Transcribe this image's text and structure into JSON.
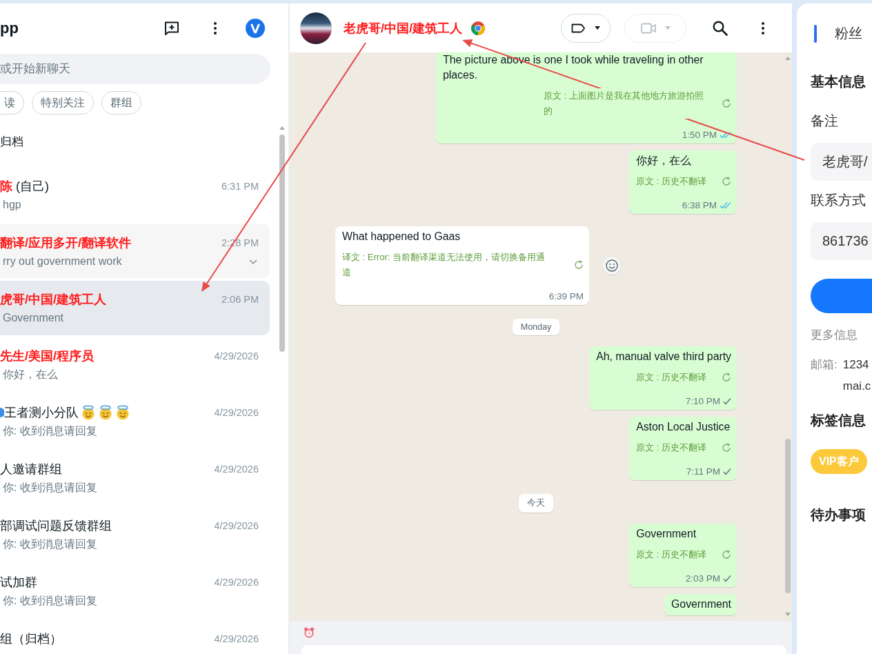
{
  "sidebar": {
    "title": "pp",
    "search": {
      "placeholder": "或开始新聊天"
    },
    "filters": [
      {
        "label": "读",
        "selected": false
      },
      {
        "label": "特别关注",
        "selected": false
      },
      {
        "label": "群组",
        "selected": false
      }
    ],
    "archived": {
      "label": "归档"
    },
    "chats": [
      {
        "name": "陈",
        "note": "(自己)",
        "highlighted": true,
        "time": "6:31 PM",
        "preview": "hgp",
        "selected": false,
        "hovered": false
      },
      {
        "name": "翻译/应用多开/翻译软件",
        "highlighted": true,
        "time": "2:28 PM",
        "preview": "rry out government work",
        "selected": false,
        "hovered": true
      },
      {
        "name": "虎哥/中国/建筑工人",
        "highlighted": true,
        "time": "2:06 PM",
        "preview": "Government",
        "selected": true,
        "hovered": false
      },
      {
        "name": "先生/美国/程序员",
        "highlighted": true,
        "time": "4/29/2026",
        "preview": "你好，在么",
        "selected": false,
        "hovered": false
      },
      {
        "name": "王者测小分队",
        "icons_before": [
          {
            "kind": "dot"
          }
        ],
        "icons_after": [
          {
            "kind": "halo-face"
          },
          {
            "kind": "halo-face"
          },
          {
            "kind": "halo-face"
          }
        ],
        "highlighted": false,
        "time": "4/29/2026",
        "preview": "你: 收到消息请回复",
        "selected": false,
        "hovered": false
      },
      {
        "name": "人邀请群组",
        "highlighted": false,
        "time": "4/29/2026",
        "preview": "你: 收到消息请回复",
        "selected": false,
        "hovered": false
      },
      {
        "name": "部调试问题反馈群组",
        "highlighted": false,
        "time": "4/29/2026",
        "preview": "你: 收到消息请回复",
        "selected": false,
        "hovered": false
      },
      {
        "name": "试加群",
        "highlighted": false,
        "time": "4/29/2026",
        "preview": "你: 收到消息请回复",
        "selected": false,
        "hovered": false
      },
      {
        "name": "组（归档）",
        "highlighted": false,
        "time": "4/29/2026",
        "selected": false,
        "hovered": false
      }
    ]
  },
  "chat": {
    "contact": {
      "name": "老虎哥/中国/建筑工人",
      "highlighted": true
    },
    "header_buttons": [
      {
        "kind": "label",
        "disabled": false
      },
      {
        "kind": "video",
        "disabled": true
      }
    ],
    "messages": [
      {
        "kind": "message",
        "outgoing": true,
        "text": "The picture above is one I took while traveling in other places.",
        "translation": "原文 : 上面图片是我在其他地方旅游拍照的",
        "time": "1:50 PM",
        "read": true
      },
      {
        "kind": "message",
        "outgoing": true,
        "text": "你好，在么",
        "translation": "原文 : 历史不翻译",
        "time": "6:38 PM",
        "read": true
      },
      {
        "kind": "message",
        "outgoing": false,
        "text": "What happened to Gaas",
        "translation": "译文 : Error: 当前翻译渠道无法使用，请切换备用通道",
        "time": "6:39 PM",
        "react_button": true
      },
      {
        "kind": "date",
        "label": "Monday"
      },
      {
        "kind": "message",
        "outgoing": true,
        "text": "Ah, manual valve third party",
        "translation": "原文 : 历史不翻译",
        "time": "7:10 PM",
        "read": false
      },
      {
        "kind": "message",
        "outgoing": true,
        "text": "Aston Local Justice",
        "translation": "原文 : 历史不翻译",
        "time": "7:11 PM",
        "read": false
      },
      {
        "kind": "date",
        "label": "今天"
      },
      {
        "kind": "message",
        "outgoing": true,
        "text": "Government",
        "translation": "原文 : 历史不翻译",
        "time": "2:03 PM",
        "read": false
      },
      {
        "kind": "message",
        "outgoing": true,
        "text": "Government"
      }
    ]
  },
  "profile": {
    "title": "粉丝",
    "basic_heading": "基本信息",
    "fields": [
      {
        "label": "备注",
        "value": "老虎哥/"
      },
      {
        "label": "联系方式",
        "value": "861736"
      }
    ],
    "more_heading": "更多信息",
    "email": {
      "label": "邮箱:",
      "lines": [
        "1234",
        "mai.c"
      ]
    },
    "tags_heading": "标签信息",
    "tags": [
      {
        "label": "VIP客户"
      }
    ],
    "todo_heading": "待办事项"
  }
}
